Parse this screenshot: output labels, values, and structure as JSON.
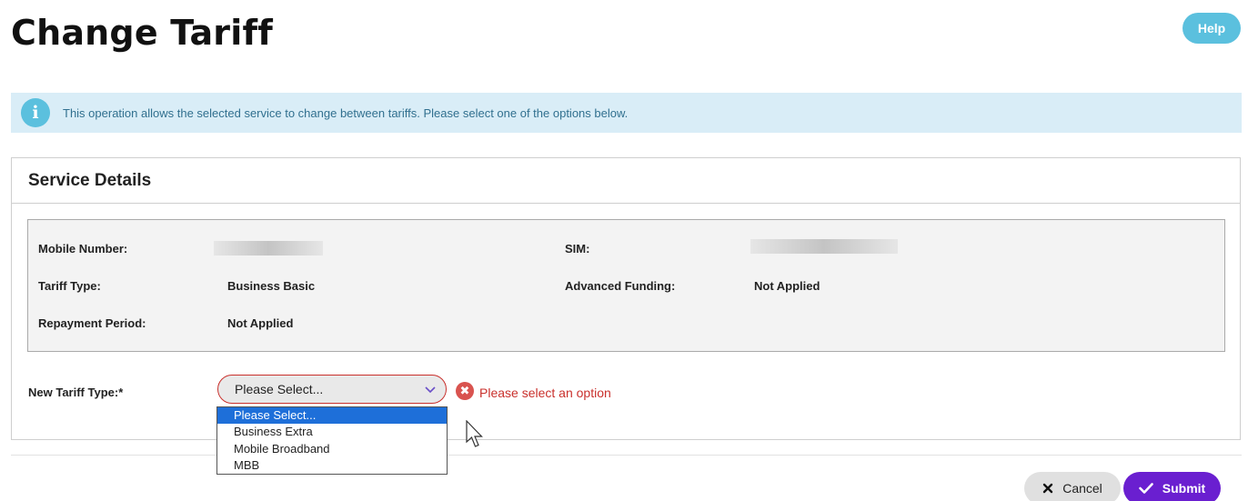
{
  "header": {
    "title": "Change Tariff",
    "help_label": "Help"
  },
  "info": {
    "icon": "info-icon",
    "glyph": "i",
    "message": "This operation allows the selected service to change between tariffs. Please select one of the options below."
  },
  "panel": {
    "title": "Service Details",
    "details": {
      "mobile_number_label": "Mobile Number:",
      "sim_label": "SIM:",
      "tariff_type_label": "Tariff Type:",
      "tariff_type_value": "Business Basic",
      "advanced_funding_label": "Advanced Funding:",
      "advanced_funding_value": "Not Applied",
      "repayment_period_label": "Repayment Period:",
      "repayment_period_value": "Not Applied"
    },
    "new_tariff": {
      "label": "New Tariff Type:*",
      "selected": "Please Select...",
      "error": "Please select an option",
      "options": [
        "Please Select...",
        "Business Extra",
        "Mobile Broadband",
        "MBB"
      ]
    }
  },
  "actions": {
    "cancel_label": "Cancel",
    "submit_label": "Submit"
  },
  "colors": {
    "help": "#5bc0de",
    "info_bg": "#d9edf7",
    "error": "#d9534f",
    "submit": "#6a1fd0",
    "dropdown_selected": "#1e6fd9"
  }
}
